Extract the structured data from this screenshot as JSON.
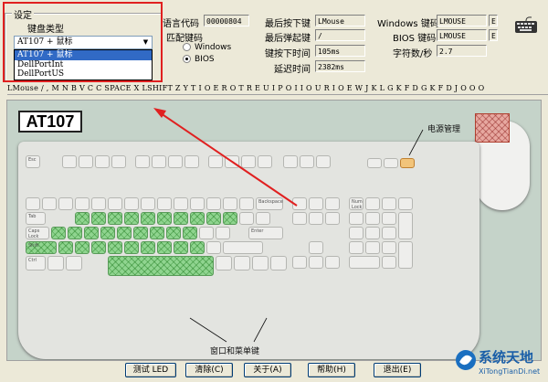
{
  "settings": {
    "group_title": "设定",
    "kb_type_label": "键盘类型",
    "kb_type_value": "AT107 + 鼠标",
    "kb_type_options": [
      "AT107 + 鼠标",
      "DellPortInt",
      "DellPortUS"
    ],
    "selected_option_index": 0
  },
  "info": {
    "lang_label": "语言代码",
    "lang_value": "00000804",
    "match_label": "匹配键码",
    "radio_windows": "Windows",
    "radio_bios": "BIOS",
    "radio_selected": "BIOS",
    "last_down_label": "最后按下键",
    "last_down_value": "LMouse",
    "last_up_label": "最后弹起键",
    "last_up_value": "/",
    "down_time_label": "键按下时间",
    "down_time_value": "105ms",
    "delay_label": "延迟时间",
    "delay_value": "2382ms",
    "win_code_label": "Windows 键码",
    "win_code_value": "LMOUSE",
    "win_code_extra": "E",
    "bios_code_label": "BIOS 键码",
    "bios_code_value": "LMOUSE",
    "bios_code_extra": "E",
    "rate_label": "字符数/秒",
    "rate_value": "2.7"
  },
  "key_history": "LMouse / , M N B V C C SPACE X LSHIFT Z Y T I O E R O T R E U I P O I I O U R I O E W J K L G K F D G K F D J O O O",
  "keyboard": {
    "brand": "AT107",
    "annotation_power": "电源管理",
    "annotation_winmenu": "窗口和菜单键",
    "key_esc": "Esc",
    "key_tab": "Tab",
    "key_caps": "Caps Lock",
    "key_shift": "Shift",
    "key_ctrl": "Ctrl",
    "key_enter": "Enter",
    "key_backspace": "Backspace",
    "key_num": "Num Lock"
  },
  "buttons": {
    "test_led": "测试 LED",
    "clear": "清除(C)",
    "about": "关于(A)",
    "help": "帮助(H)",
    "exit": "退出(E)"
  },
  "watermark": {
    "name": "系统天地",
    "url": "XiTongTianDi.net"
  },
  "colors": {
    "highlight_key": "#8fd48f",
    "selected_key": "#f2c47a",
    "red_annotation": "#e02020",
    "list_selection": "#316ac5"
  }
}
